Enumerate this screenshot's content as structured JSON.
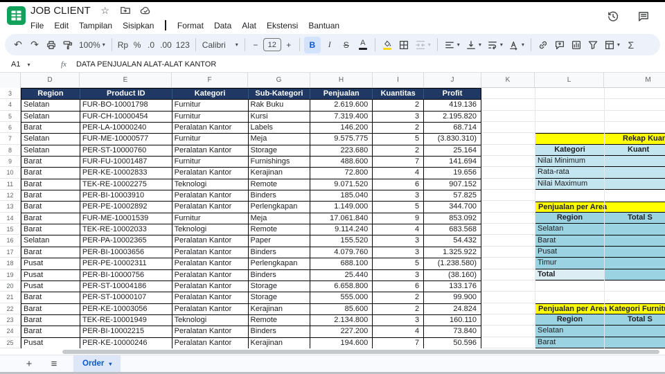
{
  "header": {
    "title": "JOB CLIENT",
    "menus": [
      "File",
      "Edit",
      "Tampilan",
      "Sisipkan",
      "Format",
      "Data",
      "Alat",
      "Ekstensi",
      "Bantuan"
    ]
  },
  "toolbar": {
    "zoom": "100%",
    "currency": "Rp",
    "percent": "%",
    "decimal_decrease": ".0",
    "decimal_increase": ".00",
    "more_formats": "123",
    "font": "Calibri",
    "font_size": "12",
    "minus": "−",
    "plus": "+",
    "bold": "B",
    "italic": "I",
    "strikethrough": "S",
    "text_color": "A",
    "functions": "Σ"
  },
  "formula_bar": {
    "cell_ref": "A1",
    "fx_label": "fx",
    "content": "DATA PENJUALAN ALAT-ALAT KANTOR"
  },
  "grid": {
    "column_letters": [
      "D",
      "E",
      "F",
      "G",
      "H",
      "I",
      "J",
      "K",
      "L",
      "M"
    ],
    "row_start": 3,
    "row_end": 25
  },
  "main_table": {
    "headers": [
      "Region",
      "Product ID",
      "Kategori",
      "Sub-Kategori",
      "Penjualan",
      "Kuantitas",
      "Profit"
    ],
    "rows": [
      [
        "Selatan",
        "FUR-BO-10001798",
        "Furnitur",
        "Rak Buku",
        "2.619.600",
        "2",
        "419.136"
      ],
      [
        "Selatan",
        "FUR-CH-10000454",
        "Furnitur",
        "Kursi",
        "7.319.400",
        "3",
        "2.195.820"
      ],
      [
        "Barat",
        "PER-LA-10000240",
        "Peralatan Kantor",
        "Labels",
        "146.200",
        "2",
        "68.714"
      ],
      [
        "Selatan",
        "FUR-ME-10000577",
        "Furnitur",
        "Meja",
        "9.575.775",
        "5",
        "(3.830.310)"
      ],
      [
        "Selatan",
        "PER-ST-10000760",
        "Peralatan Kantor",
        "Storage",
        "223.680",
        "2",
        "25.164"
      ],
      [
        "Barat",
        "FUR-FU-10001487",
        "Furnitur",
        "Furnishings",
        "488.600",
        "7",
        "141.694"
      ],
      [
        "Barat",
        "PER-KE-10002833",
        "Peralatan Kantor",
        "Kerajinan",
        "72.800",
        "4",
        "19.656"
      ],
      [
        "Barat",
        "TEK-RE-10002275",
        "Teknologi",
        "Remote",
        "9.071.520",
        "6",
        "907.152"
      ],
      [
        "Barat",
        "PER-BI-10003910",
        "Peralatan Kantor",
        "Binders",
        "185.040",
        "3",
        "57.825"
      ],
      [
        "Barat",
        "PER-PE-10002892",
        "Peralatan Kantor",
        "Perlengkapan",
        "1.149.000",
        "5",
        "344.700"
      ],
      [
        "Barat",
        "FUR-ME-10001539",
        "Furnitur",
        "Meja",
        "17.061.840",
        "9",
        "853.092"
      ],
      [
        "Barat",
        "TEK-RE-10002033",
        "Teknologi",
        "Remote",
        "9.114.240",
        "4",
        "683.568"
      ],
      [
        "Selatan",
        "PER-PA-10002365",
        "Peralatan Kantor",
        "Paper",
        "155.520",
        "3",
        "54.432"
      ],
      [
        "Barat",
        "PER-BI-10003656",
        "Peralatan Kantor",
        "Binders",
        "4.079.760",
        "3",
        "1.325.922"
      ],
      [
        "Pusat",
        "PER-PE-10002311",
        "Peralatan Kantor",
        "Perlengkapan",
        "688.100",
        "5",
        "(1.238.580)"
      ],
      [
        "Pusat",
        "PER-BI-10000756",
        "Peralatan Kantor",
        "Binders",
        "25.440",
        "3",
        "(38.160)"
      ],
      [
        "Pusat",
        "PER-ST-10004186",
        "Peralatan Kantor",
        "Storage",
        "6.658.800",
        "6",
        "133.176"
      ],
      [
        "Barat",
        "PER-ST-10000107",
        "Peralatan Kantor",
        "Storage",
        "555.000",
        "2",
        "99.900"
      ],
      [
        "Barat",
        "PER-KE-10003056",
        "Peralatan Kantor",
        "Kerajinan",
        "85.600",
        "2",
        "24.824"
      ],
      [
        "Barat",
        "TEK-RE-10001949",
        "Teknologi",
        "Remote",
        "2.134.800",
        "3",
        "160.110"
      ],
      [
        "Barat",
        "PER-BI-10002215",
        "Peralatan Kantor",
        "Binders",
        "227.200",
        "4",
        "73.840"
      ],
      [
        "Pusat",
        "PER-KE-10000246",
        "Peralatan Kantor",
        "Kerajinan",
        "194.600",
        "7",
        "50.596"
      ]
    ]
  },
  "side_tables": [
    {
      "title": "Rekap Kuant",
      "columns": [
        "Kategori",
        "Kuant"
      ],
      "rows": [
        [
          "Nilai Minimum",
          ""
        ],
        [
          "Rata-rata",
          ""
        ],
        [
          "Nilai Maximum",
          ""
        ]
      ],
      "style": "light"
    },
    {
      "title": "Penjualan per Area",
      "columns": [
        "Region",
        "Total S"
      ],
      "rows": [
        [
          "Selatan",
          ""
        ],
        [
          "Barat",
          ""
        ],
        [
          "Pusat",
          ""
        ],
        [
          "Timur",
          ""
        ],
        [
          "Total",
          ""
        ]
      ],
      "style": "mid"
    },
    {
      "title": "Penjualan per Area Kategori Furnitur",
      "columns": [
        "Region",
        "Total S"
      ],
      "rows": [
        [
          "Selatan",
          ""
        ],
        [
          "Barat",
          ""
        ]
      ],
      "style": "mid"
    }
  ],
  "sheet_tabs": {
    "add": "+",
    "all": "≡",
    "active_tab": "Order"
  },
  "colors": {
    "table_header_navy": "#1F3864",
    "highlight_yellow": "#FFFF00",
    "cell_blue_light": "#C3E5EF",
    "cell_blue_mid": "#9CD3E2",
    "cell_blue_pale": "#DCEEF4",
    "accent_blue": "#0B57D0",
    "logo_green": "#12A15A"
  }
}
